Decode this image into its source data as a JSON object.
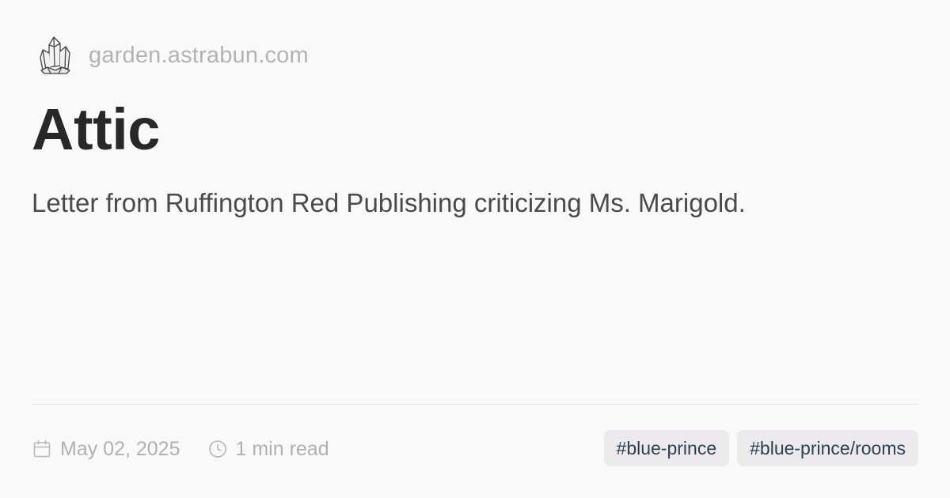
{
  "site": {
    "domain": "garden.astrabun.com",
    "logo_icon": "crystal-cluster-icon"
  },
  "page": {
    "title": "Attic",
    "description": "Letter from Ruffington Red Publishing criticizing Ms. Marigold."
  },
  "meta": {
    "date_icon": "calendar-icon",
    "date": "May 02, 2025",
    "read_time_icon": "clock-icon",
    "read_time": "1 min read"
  },
  "tags": [
    {
      "label": "#blue-prince"
    },
    {
      "label": "#blue-prince/rooms"
    }
  ],
  "colors": {
    "background": "#faf9fa",
    "title": "#282828",
    "description": "#4a4a4a",
    "muted": "#b1b1b1",
    "tag_background": "#eceaed",
    "tag_text": "#2c4250"
  }
}
